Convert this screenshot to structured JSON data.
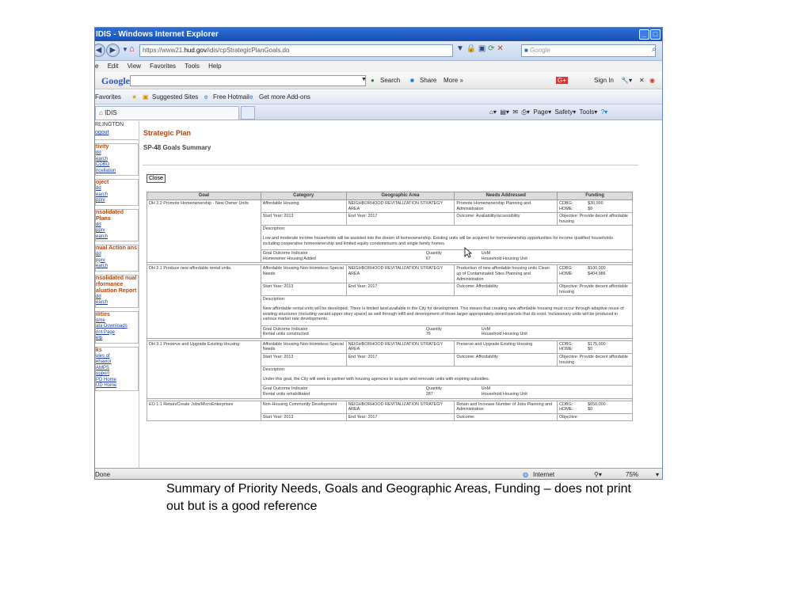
{
  "window": {
    "title": "IDIS - Windows Internet Explorer",
    "url_prefix": "https://www21.",
    "url_domain": "hud.gov",
    "url_path": "/idis/cpStrategicPlanGoals.do",
    "search_engine": "Google"
  },
  "menu": [
    "e",
    "Edit",
    "View",
    "Favorites",
    "Tools",
    "Help"
  ],
  "google_toolbar": {
    "logo": "Google",
    "search_label": "Search",
    "share_label": "Share",
    "more_label": "More »",
    "sign_in_label": "Sign In"
  },
  "favorites_bar": {
    "favorites_label": "Favorites",
    "suggested_sites": "Suggested Sites",
    "free_hotmail": "Free Hotmail",
    "get_addons": "Get more Add-ons"
  },
  "tab": {
    "label": "IDIS"
  },
  "command_bar": {
    "page": "Page",
    "safety": "Safety",
    "tools": "Tools"
  },
  "sidebar": {
    "city": "RLINGTON",
    "logout": "ogout",
    "sections": [
      {
        "heading": "tivity",
        "links": [
          "dd",
          "earch",
          "CDBG",
          "ncellation"
        ]
      },
      {
        "heading": "oject",
        "links": [
          "dd",
          "earch",
          "pprv"
        ]
      },
      {
        "heading": "nsolidated Plans",
        "links": [
          "dd",
          "pprv",
          "earch"
        ]
      },
      {
        "heading": "nual Action ans",
        "links": [
          "dd",
          "pprv",
          "earch"
        ]
      },
      {
        "heading": "nsolidated nual rformance aluation Report",
        "links": [
          "dd",
          "earch"
        ]
      },
      {
        "heading": "ilities",
        "links": [
          "ome",
          "ata Downloads",
          "rint Page",
          "elp"
        ]
      },
      {
        "heading": "ks",
        "links": [
          "ules of",
          "ehavior",
          "AMPS",
          "upport",
          "PD Home",
          "UD Home"
        ]
      }
    ]
  },
  "page": {
    "title": "Strategic Plan",
    "subtitle": "SP-48 Goals Summary",
    "close_button": "Close"
  },
  "table": {
    "headers": [
      "Goal",
      "Category",
      "Geographic Area",
      "Needs Addressed",
      "Funding"
    ],
    "goals": [
      {
        "goal": "DH 2.2 Promote Homeownership - New Owner Units",
        "category": "Affordable Housing",
        "area": "NEIGHBORHOOD REVITALIZATION STRATEGY AREA",
        "needs": "Promote Homeownership Planning and Administration",
        "funding_lines": [
          "CDBG:",
          "$30,000",
          "HOME:",
          "$0"
        ],
        "start_year": "Start Year: 2013",
        "end_year": "End Year: 2017",
        "outcome": "Outcome: Availability/accessibility",
        "objective": "Objective: Provide decent affordable housing",
        "description_label": "Description:",
        "description": "Low and moderate income households will be assisted into the dream of homeownership.  Existing units will be acquired for homeownership opportunities for income qualified households including cooperative homeownership and limited equity condominiums and single family homes.",
        "indicator_label": "Goal Outcome Indicator",
        "indicator": "Homeowner Housing Added",
        "quantity_label": "Quantity",
        "quantity": "67",
        "uom_label": "UoM",
        "uom": "Household Housing Unit"
      },
      {
        "goal": "DH 2.1 Produce new affordable rental units.",
        "category": "Affordable Housing Non-Homeless Special Needs",
        "area": "NEIGHBORHOOD REVITALIZATION STRATEGY AREA",
        "needs": "Production of new affordable housing units Clean up of Contaminated Sites Planning and Administration",
        "funding_lines": [
          "CDBG:",
          "$100,000",
          "HOME:",
          "$404,986"
        ],
        "start_year": "Start Year: 2013",
        "end_year": "End Year: 2017",
        "outcome": "Outcome: Affordability",
        "objective": "Objective: Provide decent affordable housing",
        "description_label": "Description:",
        "description": "New affordable rental units will be developed. There is limited land available in the City for development.  This means that creating new affordable housing must occur through adaptive reuse of existing structures (including vacant upper story space) as well through infill and development of those larger appropriately-zoned parcels that do exist. Inclusionary units will be produced in various market rate developments.",
        "indicator_label": "Goal Outcome Indicator",
        "indicator": "Rental units constructed",
        "quantity_label": "Quantity",
        "quantity": "75",
        "uom_label": "UoM",
        "uom": "Household Housing Unit"
      },
      {
        "goal": "DH 3.1 Preserve and Upgrade Existing Housing",
        "category": "Affordable Housing Non-Homeless Special Needs",
        "area": "NEIGHBORHOOD REVITALIZATION STRATEGY AREA",
        "needs": "Preserve and Upgrade Existing Housing",
        "funding_lines": [
          "CDBG:",
          "$175,000",
          "HOME:",
          "$0"
        ],
        "start_year": "Start Year: 2013",
        "end_year": "End Year: 2017",
        "outcome": "Outcome: Affordability",
        "objective": "Objective: Provide decent affordable housing",
        "description_label": "Description:",
        "description": "Under this goal, the City will seek to partner with housing agencies to acquire and renovate units with expiring subsidies.",
        "indicator_label": "Goal Outcome Indicator",
        "indicator": "Rental units rehabilitated",
        "quantity_label": "Quantity",
        "quantity": "287",
        "uom_label": "UoM",
        "uom": "Household Housing Unit"
      },
      {
        "goal": "EO 1.1 Retain/Create Jobs/MicroEnterprises",
        "category": "Non-Housing Community Development",
        "area": "NEIGHBORHOOD REVITALIZATION STRATEGY AREA",
        "needs": "Retain and Increase Number of Jobs Planning and Administration",
        "funding_lines": [
          "CDBG:",
          "$650,000",
          "HOME:",
          "$0"
        ],
        "start_year": "Start Year: 2013",
        "end_year": "End Year: 2017",
        "outcome": "Outcome:",
        "objective": "Objective:"
      }
    ]
  },
  "statusbar": {
    "status": "Done",
    "zone": "Internet",
    "zoom": "75%"
  },
  "caption": "Summary of Priority Needs, Goals and Geographic Areas, Funding – does not print out but is a good reference"
}
